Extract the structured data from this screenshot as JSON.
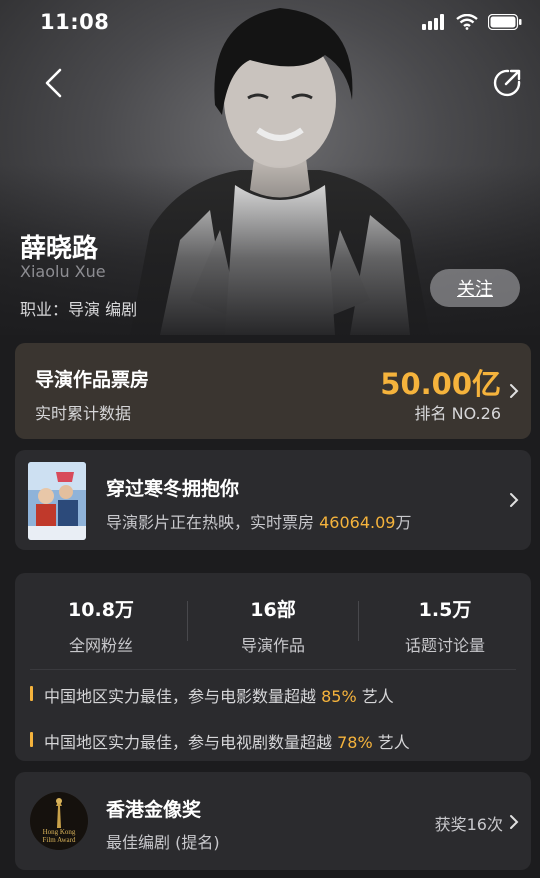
{
  "status": {
    "time": "11:08"
  },
  "person": {
    "name_zh": "薛晓路",
    "name_en": "Xiaolu Xue",
    "job": "职业：导演 编剧",
    "follow_label": "关注"
  },
  "box_office": {
    "title": "导演作品票房",
    "subtitle": "实时累计数据",
    "value": "50.00亿",
    "rank": "排名 NO.26"
  },
  "now_showing": {
    "title": "穿过寒冬拥抱你",
    "subtitle_prefix": "导演影片正在热映，实时票房 ",
    "box_office": "46064.09",
    "unit": "万"
  },
  "stats": {
    "items": [
      {
        "value": "10.8万",
        "label": "全网粉丝"
      },
      {
        "value": "16部",
        "label": "导演作品"
      },
      {
        "value": "1.5万",
        "label": "话题讨论量"
      }
    ],
    "rankings": [
      {
        "prefix": "中国地区实力最佳，参与电影数量超越 ",
        "percent": "85%",
        "suffix": " 艺人"
      },
      {
        "prefix": "中国地区实力最佳，参与电视剧数量超越 ",
        "percent": "78%",
        "suffix": " 艺人"
      }
    ]
  },
  "award": {
    "title": "香港金像奖",
    "subtitle": "最佳编剧 (提名)",
    "count": "获奖16次",
    "badge_text": [
      "Hong Kong",
      "Film Award"
    ]
  },
  "colors": {
    "accent": "#f5b33c",
    "background": "#1c1c1e",
    "card": "#2b2b2e"
  }
}
